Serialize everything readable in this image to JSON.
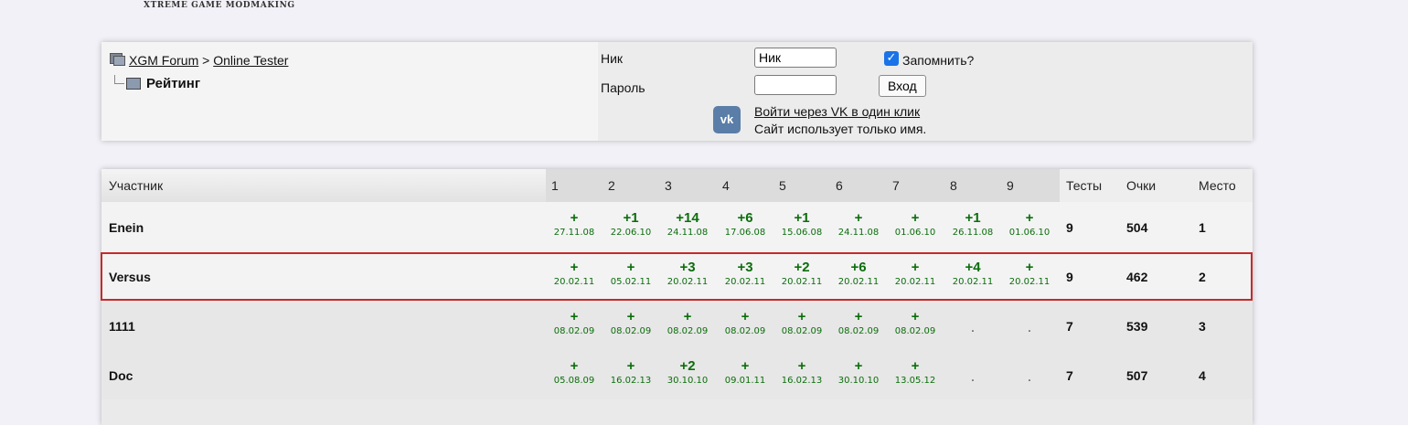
{
  "logo_text": "XTREME GAME MODMAKING",
  "breadcrumb": {
    "forum_link": "XGM Forum",
    "separator": ">",
    "section_link": "Online Tester",
    "current": "Рейтинг"
  },
  "login": {
    "nick_label": "Ник",
    "nick_value": "Ник",
    "password_label": "Пароль",
    "password_value": "",
    "remember_label": "Запомнить?",
    "remember_checked": true,
    "submit_label": "Вход",
    "vk_logo": "vk",
    "vk_link": "Войти через VK в один клик",
    "vk_note": "Сайт использует только имя."
  },
  "table": {
    "headers": {
      "participant": "Участник",
      "tests": [
        "1",
        "2",
        "3",
        "4",
        "5",
        "6",
        "7",
        "8",
        "9"
      ],
      "tests_count": "Тесты",
      "points": "Очки",
      "place": "Место"
    },
    "rows": [
      {
        "name": "Enein",
        "results": [
          {
            "score": "+",
            "date": "27.11.08"
          },
          {
            "score": "+1",
            "date": "22.06.10"
          },
          {
            "score": "+14",
            "date": "24.11.08"
          },
          {
            "score": "+6",
            "date": "17.06.08"
          },
          {
            "score": "+1",
            "date": "15.06.08"
          },
          {
            "score": "+",
            "date": "24.11.08"
          },
          {
            "score": "+",
            "date": "01.06.10"
          },
          {
            "score": "+1",
            "date": "26.11.08"
          },
          {
            "score": "+",
            "date": "01.06.10"
          }
        ],
        "tests": "9",
        "points": "504",
        "place": "1"
      },
      {
        "name": "Versus",
        "results": [
          {
            "score": "+",
            "date": "20.02.11"
          },
          {
            "score": "+",
            "date": "05.02.11"
          },
          {
            "score": "+3",
            "date": "20.02.11"
          },
          {
            "score": "+3",
            "date": "20.02.11"
          },
          {
            "score": "+2",
            "date": "20.02.11"
          },
          {
            "score": "+6",
            "date": "20.02.11"
          },
          {
            "score": "+",
            "date": "20.02.11"
          },
          {
            "score": "+4",
            "date": "20.02.11"
          },
          {
            "score": "+",
            "date": "20.02.11"
          }
        ],
        "tests": "9",
        "points": "462",
        "place": "2"
      },
      {
        "name": "1111",
        "results": [
          {
            "score": "+",
            "date": "08.02.09"
          },
          {
            "score": "+",
            "date": "08.02.09"
          },
          {
            "score": "+",
            "date": "08.02.09"
          },
          {
            "score": "+",
            "date": "08.02.09"
          },
          {
            "score": "+",
            "date": "08.02.09"
          },
          {
            "score": "+",
            "date": "08.02.09"
          },
          {
            "score": "+",
            "date": "08.02.09"
          },
          {
            "score": ".",
            "date": ""
          },
          {
            "score": ".",
            "date": ""
          }
        ],
        "tests": "7",
        "points": "539",
        "place": "3"
      },
      {
        "name": "Doc",
        "results": [
          {
            "score": "+",
            "date": "05.08.09"
          },
          {
            "score": "+",
            "date": "16.02.13"
          },
          {
            "score": "+2",
            "date": "30.10.10"
          },
          {
            "score": "+",
            "date": "09.01.11"
          },
          {
            "score": "+",
            "date": "16.02.13"
          },
          {
            "score": "+",
            "date": "30.10.10"
          },
          {
            "score": "+",
            "date": "13.05.12"
          },
          {
            "score": ".",
            "date": ""
          },
          {
            "score": ".",
            "date": ""
          }
        ],
        "tests": "7",
        "points": "507",
        "place": "4"
      }
    ]
  }
}
